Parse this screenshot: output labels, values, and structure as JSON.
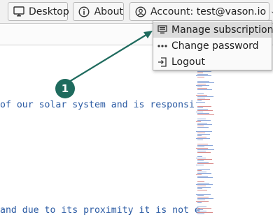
{
  "topbar": {
    "desktop_label": "Desktop",
    "about_label": "About",
    "account_label": "Account: test@vason.io"
  },
  "menu": {
    "items": [
      {
        "label": "Manage subscriptions",
        "icon": "subscriptions-icon"
      },
      {
        "label": "Change password",
        "icon": "password-dots-icon"
      },
      {
        "label": "Logout",
        "icon": "logout-icon"
      }
    ]
  },
  "editor": {
    "line1": "of our solar system and is responsi",
    "line2": "and due to its proximity it is not e"
  },
  "annotation": {
    "badge": "1",
    "color": "#1f6b5e"
  }
}
